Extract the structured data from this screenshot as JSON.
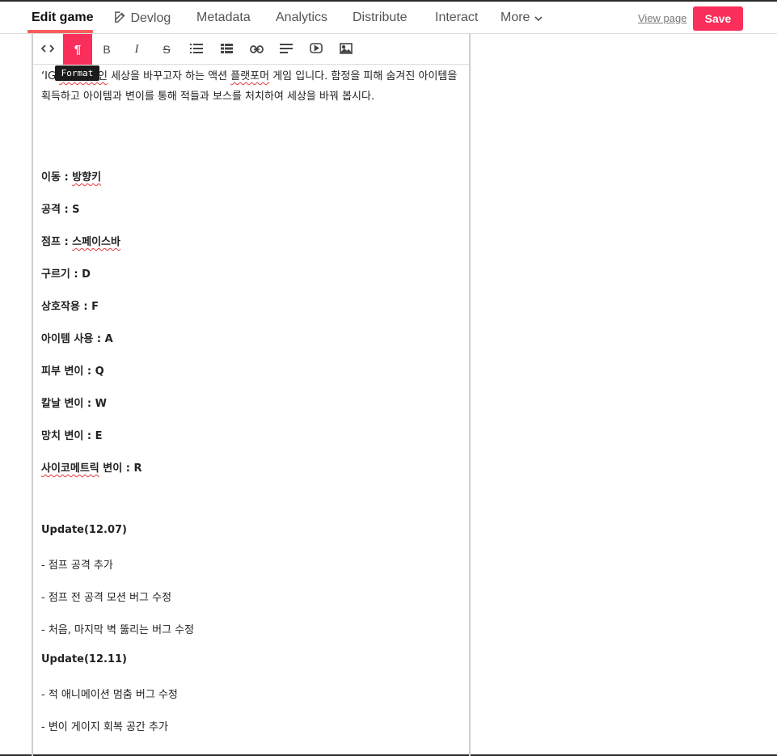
{
  "nav": {
    "tabs": [
      {
        "label": "Edit game"
      },
      {
        "label": "Devlog"
      },
      {
        "label": "Metadata"
      },
      {
        "label": "Analytics"
      },
      {
        "label": "Distribute"
      },
      {
        "label": "Interact"
      },
      {
        "label": "More"
      }
    ],
    "view_page": "View page",
    "save": "Save",
    "accent_color": "#fa2e5a"
  },
  "toolbar": {
    "buttons": [
      {
        "icon": "code-icon"
      },
      {
        "icon": "paragraph-format-icon",
        "glyph": "¶",
        "active": true
      },
      {
        "icon": "bold-icon",
        "glyph": "B"
      },
      {
        "icon": "italic-icon",
        "glyph": "I"
      },
      {
        "icon": "strikethrough-icon",
        "glyph": "S"
      },
      {
        "icon": "bullet-list-icon"
      },
      {
        "icon": "table-icon"
      },
      {
        "icon": "link-icon"
      },
      {
        "icon": "align-icon"
      },
      {
        "icon": "video-embed-icon"
      },
      {
        "icon": "image-icon"
      }
    ],
    "tooltip": "Format"
  },
  "content": {
    "intro_p1": "‘IG",
    "intro_p2": "포칼립스인",
    "intro_p3": " 세상을 바꾸고자 하는 액션 ",
    "intro_p4": "플랫포머",
    "intro_p5": " 게임 입니다. 함정을 피해 숨겨진 아이템을 획득하고 아이템과 변이를 통해 적들과 보스를 처치하여 세상을 바꿔 봅시다.",
    "controls": [
      {
        "name": "이동 : ",
        "key": "방향키",
        "squiggle": true
      },
      {
        "name": "공격 : ",
        "key": "S"
      },
      {
        "name": "점프 : ",
        "key": "스페이스바",
        "squiggle": true
      },
      {
        "name": "구르기 : ",
        "key": "D"
      },
      {
        "name": "상호작용 : ",
        "key": "F"
      },
      {
        "name": "아이템 사용 : ",
        "key": "A"
      },
      {
        "name": "피부 변이 : ",
        "key": "Q"
      },
      {
        "name": "칼날 변이 : ",
        "key": "W"
      },
      {
        "name": "망치 변이 : ",
        "key": "E"
      },
      {
        "name_sq": "사이코메트릭",
        "name": " 변이 : ",
        "key": "R"
      }
    ],
    "update1": {
      "title": "Update(12.07)",
      "items": [
        "- 점프 공격 추가",
        "- 점프 전 공격 모션 버그 수정",
        "- 처음, 마지막 벽 뚫리는 버그 수정"
      ]
    },
    "update2": {
      "title": "Update(12.11)",
      "items": [
        "- 적 애니메이션 멈춤 버그 수정",
        "- 변이 게이지 회복 공간 추가"
      ]
    }
  }
}
